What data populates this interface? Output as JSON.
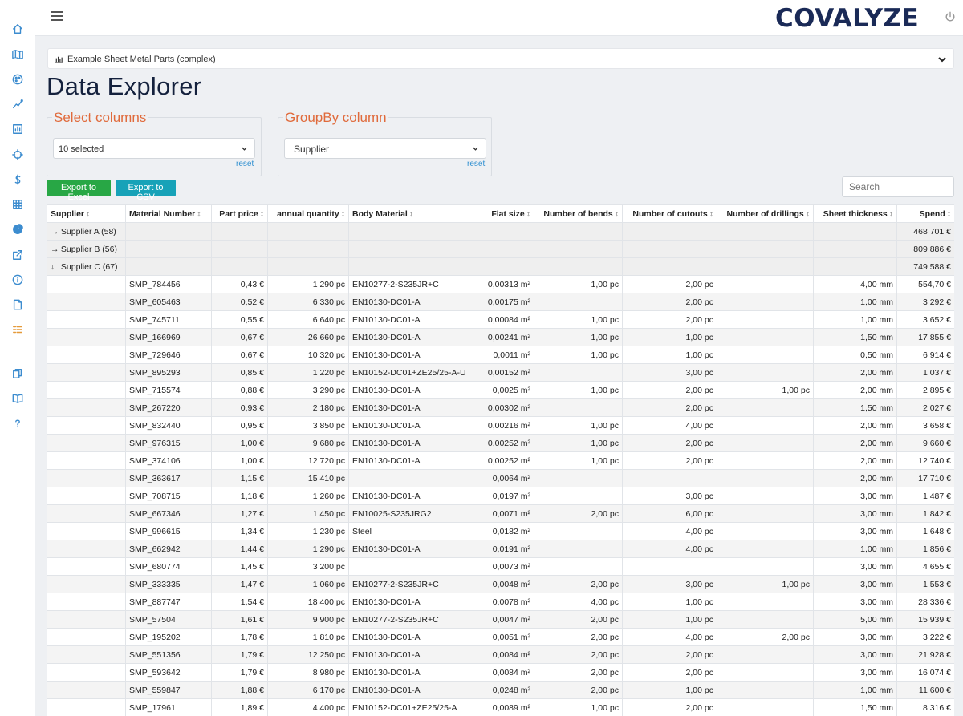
{
  "brand": {
    "logo_text": "COVALYZE",
    "accent": "#1a2a57"
  },
  "rail_icons": [
    "home-icon",
    "map-icon",
    "palette-icon",
    "chart-line-icon",
    "report-icon",
    "crosshair-icon",
    "dollar-icon",
    "grid-icon",
    "pie-chart-icon",
    "external-link-icon",
    "info-icon",
    "document-icon",
    "list-icon",
    "copy-icon",
    "book-icon",
    "help-icon"
  ],
  "dataset": {
    "label": "Example Sheet Metal Parts (complex)"
  },
  "page_title": "Data Explorer",
  "select_columns": {
    "legend": "Select columns",
    "value": "10 selected",
    "reset": "reset"
  },
  "groupby": {
    "legend": "GroupBy column",
    "value": "Supplier",
    "reset": "reset"
  },
  "buttons": {
    "excel": "Export to Excel",
    "csv": "Export to CSV"
  },
  "search": {
    "placeholder": "Search"
  },
  "sort_glyph": "↕",
  "columns": [
    "Supplier",
    "Material Number",
    "Part price",
    "annual quantity",
    "Body Material",
    "Flat size",
    "Number of bends",
    "Number of cutouts",
    "Number of drillings",
    "Sheet thickness",
    "Spend"
  ],
  "groups": [
    {
      "arrow": "→",
      "label": "Supplier A (58)",
      "spend": "468 701 €"
    },
    {
      "arrow": "→",
      "label": "Supplier B (56)",
      "spend": "809 886 €"
    },
    {
      "arrow": "↓",
      "label": "Supplier C (67)",
      "spend": "749 588 €"
    }
  ],
  "rows": [
    [
      "",
      "SMP_784456",
      "0,43 €",
      "1 290 pc",
      "EN10277-2-S235JR+C",
      "0,00313 m²",
      "1,00 pc",
      "2,00 pc",
      "",
      "4,00 mm",
      "554,70 €"
    ],
    [
      "",
      "SMP_605463",
      "0,52 €",
      "6 330 pc",
      "EN10130-DC01-A",
      "0,00175 m²",
      "",
      "2,00 pc",
      "",
      "1,00 mm",
      "3 292 €"
    ],
    [
      "",
      "SMP_745711",
      "0,55 €",
      "6 640 pc",
      "EN10130-DC01-A",
      "0,00084 m²",
      "1,00 pc",
      "2,00 pc",
      "",
      "1,00 mm",
      "3 652 €"
    ],
    [
      "",
      "SMP_166969",
      "0,67 €",
      "26 660 pc",
      "EN10130-DC01-A",
      "0,00241 m²",
      "1,00 pc",
      "1,00 pc",
      "",
      "1,50 mm",
      "17 855 €"
    ],
    [
      "",
      "SMP_729646",
      "0,67 €",
      "10 320 pc",
      "EN10130-DC01-A",
      "0,0011 m²",
      "1,00 pc",
      "1,00 pc",
      "",
      "0,50 mm",
      "6 914 €"
    ],
    [
      "",
      "SMP_895293",
      "0,85 €",
      "1 220 pc",
      "EN10152-DC01+ZE25/25-A-U",
      "0,00152 m²",
      "",
      "3,00 pc",
      "",
      "2,00 mm",
      "1 037 €"
    ],
    [
      "",
      "SMP_715574",
      "0,88 €",
      "3 290 pc",
      "EN10130-DC01-A",
      "0,0025 m²",
      "1,00 pc",
      "2,00 pc",
      "1,00 pc",
      "2,00 mm",
      "2 895 €"
    ],
    [
      "",
      "SMP_267220",
      "0,93 €",
      "2 180 pc",
      "EN10130-DC01-A",
      "0,00302 m²",
      "",
      "2,00 pc",
      "",
      "1,50 mm",
      "2 027 €"
    ],
    [
      "",
      "SMP_832440",
      "0,95 €",
      "3 850 pc",
      "EN10130-DC01-A",
      "0,00216 m²",
      "1,00 pc",
      "4,00 pc",
      "",
      "2,00 mm",
      "3 658 €"
    ],
    [
      "",
      "SMP_976315",
      "1,00 €",
      "9 680 pc",
      "EN10130-DC01-A",
      "0,00252 m²",
      "1,00 pc",
      "2,00 pc",
      "",
      "2,00 mm",
      "9 660 €"
    ],
    [
      "",
      "SMP_374106",
      "1,00 €",
      "12 720 pc",
      "EN10130-DC01-A",
      "0,00252 m²",
      "1,00 pc",
      "2,00 pc",
      "",
      "2,00 mm",
      "12 740 €"
    ],
    [
      "",
      "SMP_363617",
      "1,15 €",
      "15 410 pc",
      "",
      "0,0064 m²",
      "",
      "",
      "",
      "2,00 mm",
      "17 710 €"
    ],
    [
      "",
      "SMP_708715",
      "1,18 €",
      "1 260 pc",
      "EN10130-DC01-A",
      "0,0197 m²",
      "",
      "3,00 pc",
      "",
      "3,00 mm",
      "1 487 €"
    ],
    [
      "",
      "SMP_667346",
      "1,27 €",
      "1 450 pc",
      "EN10025-S235JRG2",
      "0,0071 m²",
      "2,00 pc",
      "6,00 pc",
      "",
      "3,00 mm",
      "1 842 €"
    ],
    [
      "",
      "SMP_996615",
      "1,34 €",
      "1 230 pc",
      "Steel",
      "0,0182 m²",
      "",
      "4,00 pc",
      "",
      "3,00 mm",
      "1 648 €"
    ],
    [
      "",
      "SMP_662942",
      "1,44 €",
      "1 290 pc",
      "EN10130-DC01-A",
      "0,0191 m²",
      "",
      "4,00 pc",
      "",
      "1,00 mm",
      "1 856 €"
    ],
    [
      "",
      "SMP_680774",
      "1,45 €",
      "3 200 pc",
      "",
      "0,0073 m²",
      "",
      "",
      "",
      "3,00 mm",
      "4 655 €"
    ],
    [
      "",
      "SMP_333335",
      "1,47 €",
      "1 060 pc",
      "EN10277-2-S235JR+C",
      "0,0048 m²",
      "2,00 pc",
      "3,00 pc",
      "1,00 pc",
      "3,00 mm",
      "1 553 €"
    ],
    [
      "",
      "SMP_887747",
      "1,54 €",
      "18 400 pc",
      "EN10130-DC01-A",
      "0,0078 m²",
      "4,00 pc",
      "1,00 pc",
      "",
      "3,00 mm",
      "28 336 €"
    ],
    [
      "",
      "SMP_57504",
      "1,61 €",
      "9 900 pc",
      "EN10277-2-S235JR+C",
      "0,0047 m²",
      "2,00 pc",
      "1,00 pc",
      "",
      "5,00 mm",
      "15 939 €"
    ],
    [
      "",
      "SMP_195202",
      "1,78 €",
      "1 810 pc",
      "EN10130-DC01-A",
      "0,0051 m²",
      "2,00 pc",
      "4,00 pc",
      "2,00 pc",
      "3,00 mm",
      "3 222 €"
    ],
    [
      "",
      "SMP_551356",
      "1,79 €",
      "12 250 pc",
      "EN10130-DC01-A",
      "0,0084 m²",
      "2,00 pc",
      "2,00 pc",
      "",
      "3,00 mm",
      "21 928 €"
    ],
    [
      "",
      "SMP_593642",
      "1,79 €",
      "8 980 pc",
      "EN10130-DC01-A",
      "0,0084 m²",
      "2,00 pc",
      "2,00 pc",
      "",
      "3,00 mm",
      "16 074 €"
    ],
    [
      "",
      "SMP_559847",
      "1,88 €",
      "6 170 pc",
      "EN10130-DC01-A",
      "0,0248 m²",
      "2,00 pc",
      "1,00 pc",
      "",
      "1,00 mm",
      "11 600 €"
    ],
    [
      "",
      "SMP_17961",
      "1,89 €",
      "4 400 pc",
      "EN10152-DC01+ZE25/25-A",
      "0,0089 m²",
      "1,00 pc",
      "2,00 pc",
      "",
      "1,50 mm",
      "8 316 €"
    ]
  ]
}
